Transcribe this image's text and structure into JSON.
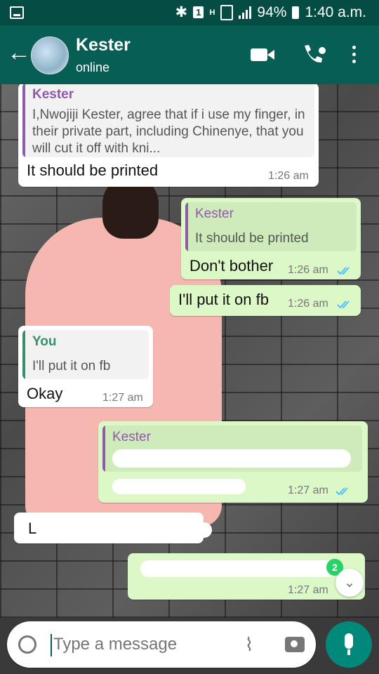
{
  "status_bar": {
    "sim": "1",
    "network": "H",
    "battery": "94%",
    "time": "1:40 a.m."
  },
  "header": {
    "contact_name": "Kester",
    "contact_status": "online"
  },
  "messages": [
    {
      "quote": {
        "name": "Kester",
        "text": "I,Nwojiji Kester, agree that if i use my finger, in their private part, including Chinenye, that you will cut it off with kni..."
      },
      "text": "It should be printed",
      "time": "1:26 am"
    },
    {
      "quote": {
        "name": "Kester",
        "text": "It should be printed"
      },
      "text": "Don't bother",
      "time": "1:26 am"
    },
    {
      "text": "I'll put it on fb",
      "time": "1:26 am"
    },
    {
      "quote": {
        "name": "You",
        "text": "I'll put it on fb"
      },
      "text": "Okay",
      "time": "1:27 am"
    },
    {
      "quote": {
        "name": "Kester",
        "text": ""
      },
      "text": "",
      "time": "1:27 am"
    },
    {
      "text": "L"
    },
    {
      "text": "",
      "time": "1:27 am",
      "unread_count": "2"
    }
  ],
  "composer": {
    "placeholder": "Type a message"
  },
  "colors": {
    "header": "#075e54",
    "status_bar": "#054d44",
    "outgoing_bubble": "#dcf8c6",
    "incoming_bubble": "#ffffff",
    "quote_kester": "#8e5ba8",
    "quote_you": "#35906b",
    "read_ticks": "#4fc3f7",
    "mic": "#00897b"
  }
}
